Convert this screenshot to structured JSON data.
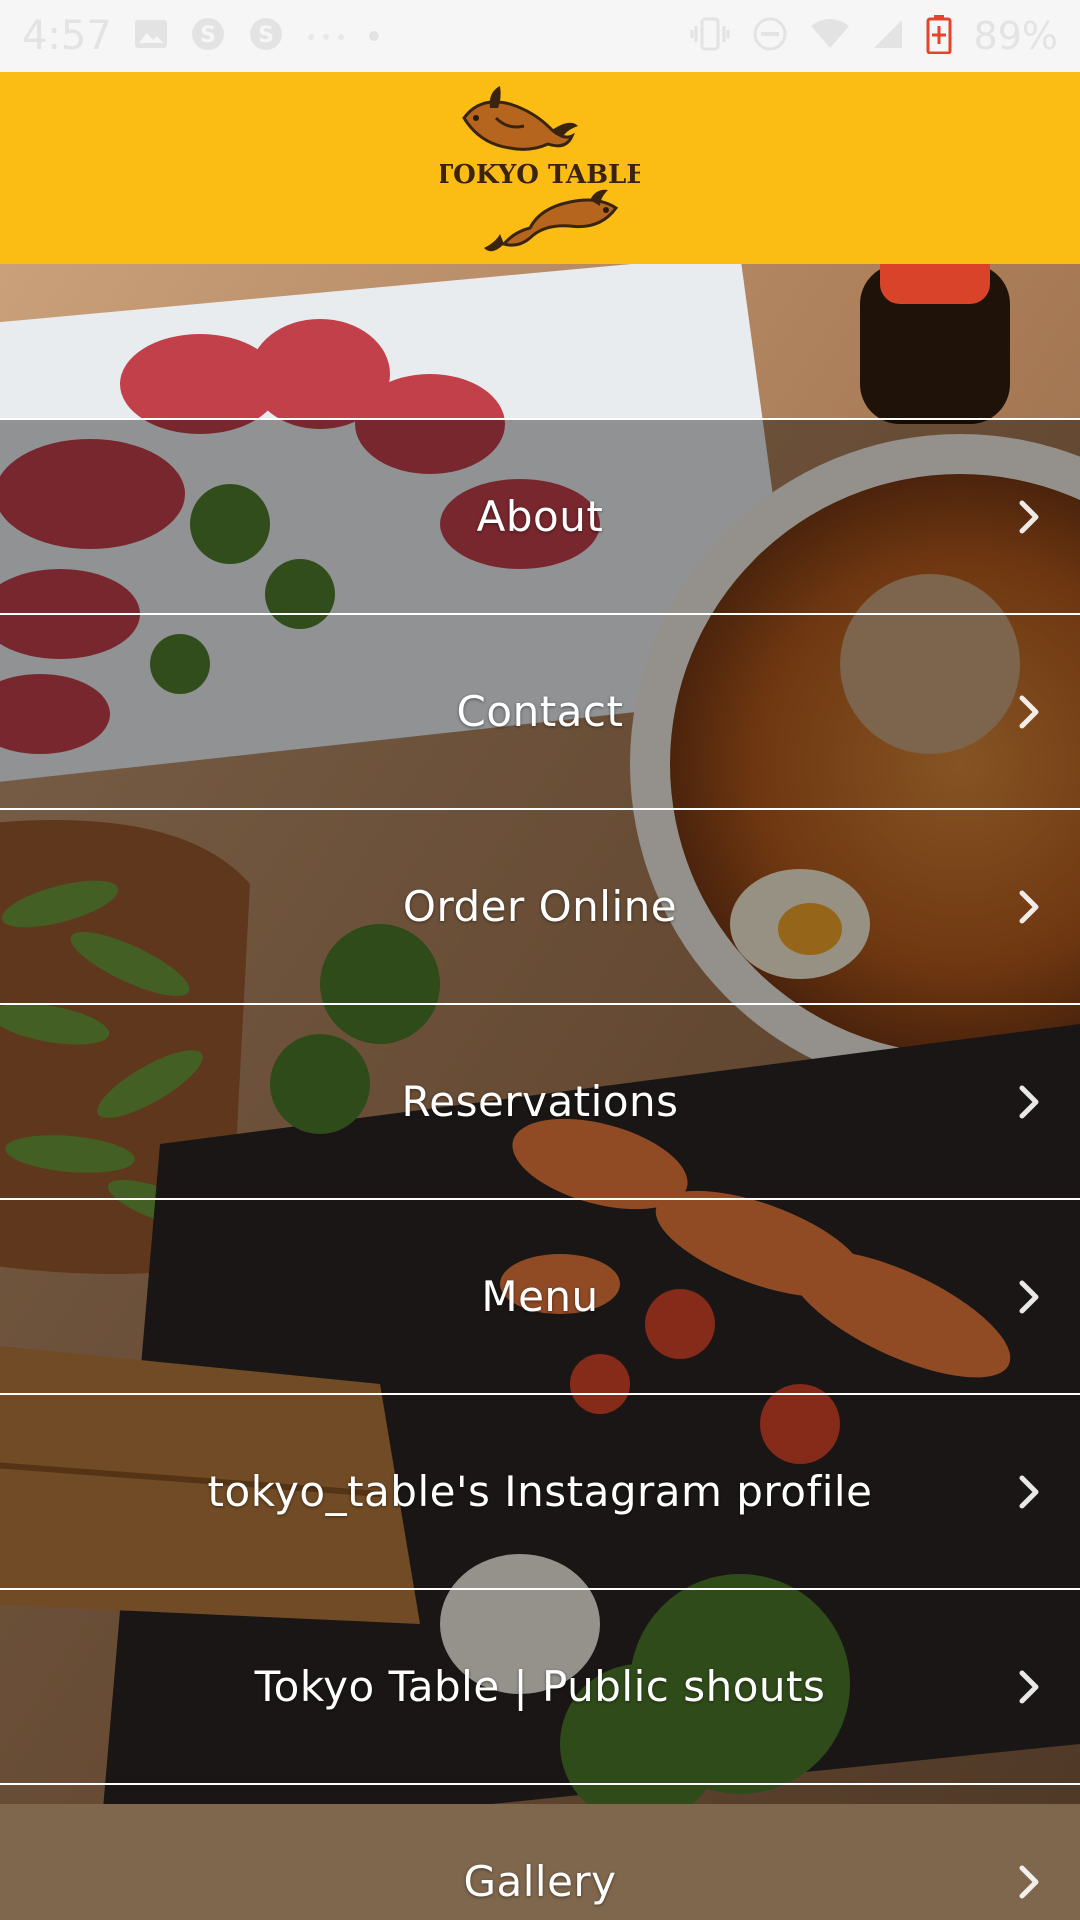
{
  "status_bar": {
    "time": "4:57",
    "battery_percent": "89%",
    "icons": [
      "image-icon",
      "skype-icon",
      "skype-icon",
      "dots-icon",
      "vibrate-icon",
      "do-not-disturb-icon",
      "wifi-icon",
      "signal-icon",
      "battery-charging-icon"
    ]
  },
  "header": {
    "logo_text": "TOKYO TABLE",
    "background_color": "#fbbd14"
  },
  "menu": {
    "items": [
      {
        "label": "About",
        "icon": "chevron-right-icon"
      },
      {
        "label": "Contact",
        "icon": "chevron-right-icon"
      },
      {
        "label": "Order Online",
        "icon": "chevron-right-icon"
      },
      {
        "label": "Reservations",
        "icon": "chevron-right-icon"
      },
      {
        "label": "Menu",
        "icon": "chevron-right-icon"
      },
      {
        "label": "tokyo_table's Instagram profile",
        "icon": "chevron-right-icon"
      },
      {
        "label": "Tokyo Table | Public shouts",
        "icon": "chevron-right-icon"
      },
      {
        "label": "Gallery",
        "icon": "chevron-right-icon"
      }
    ]
  },
  "colors": {
    "accent": "#fbbd14",
    "divider": "#ffffff",
    "label": "#ffffff"
  }
}
